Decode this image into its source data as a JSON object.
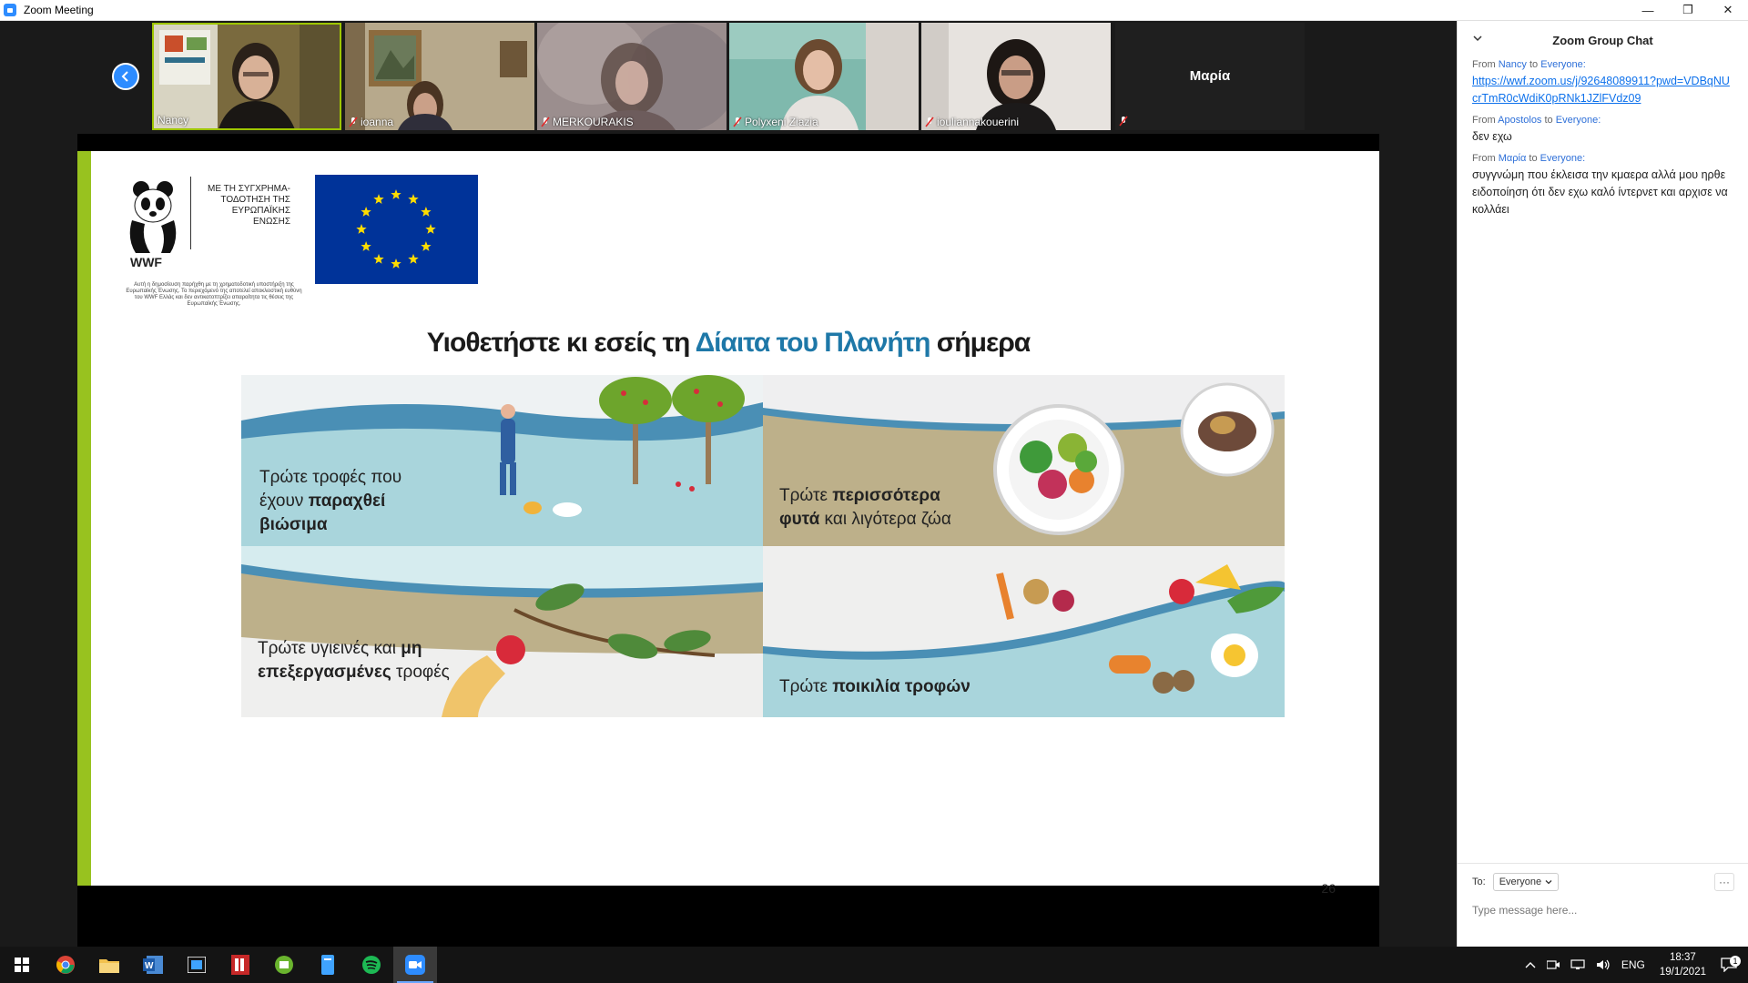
{
  "window": {
    "title": "Zoom Meeting",
    "controls": {
      "minimize": "—",
      "restore": "❐",
      "close": "✕"
    }
  },
  "participants": [
    {
      "name": "Nancy",
      "muted": false,
      "speaking": true
    },
    {
      "name": "ioanna",
      "muted": true
    },
    {
      "name": "MERKOURAKIS",
      "muted": true
    },
    {
      "name": "Polyxeni Ziazia",
      "muted": true
    },
    {
      "name": "iouliannakouerini",
      "muted": true
    },
    {
      "name": "Μαρία",
      "muted": true,
      "video_off": true
    }
  ],
  "slide": {
    "logo_text": "WWF",
    "cofund_text": "ΜΕ ΤΗ ΣΥΓΧΡΗΜΑ-ΤΟΔΟΤΗΣΗ ΤΗΣ ΕΥΡΩΠΑΪΚΗΣ ΕΝΩΣΗΣ",
    "disclaimer": "Αυτή η δημοσίευση παρήχθη με τη χρηματοδοτική υποστήριξη της Ευρωπαϊκής Ένωσης. Το περιεχόμενό της αποτελεί αποκλειστική ευθύνη του WWF Ελλάς και δεν αντικατοπτρίζει απαραίτητα τις θέσεις της Ευρωπαϊκής Ένωσης.",
    "title_start": "Υιοθετήστε κι εσείς τη ",
    "title_accent": "Δίαιτα του Πλανήτη",
    "title_end": " σήμερα",
    "panels": [
      {
        "text_a": "Τρώτε τροφές που έχουν ",
        "text_b": "παραχθεί βιώσιμα"
      },
      {
        "text_a": "Τρώτε ",
        "text_b": "περισσότερα φυτά",
        "text_c": " και λιγότερα ζώα"
      },
      {
        "text_a": "Τρώτε υγιεινές και ",
        "text_b": "μη επεξεργασμένες",
        "text_c": " τροφές"
      },
      {
        "text_a": "Τρώτε ",
        "text_b": "ποικιλία τροφών"
      }
    ],
    "page_number": "26"
  },
  "chat": {
    "title": "Zoom Group Chat",
    "messages": [
      {
        "from": "Nancy",
        "to": "Everyone:",
        "body": "https://wwf.zoom.us/j/92648089911?pwd=VDBqNUcrTmR0cWdiK0pRNk1JZlFVdz09",
        "is_link": true
      },
      {
        "from": "Apostolos",
        "to": "Everyone:",
        "body": "δεν εχω",
        "is_link": false
      },
      {
        "from": "Μαρία",
        "to": "Everyone:",
        "body": "συγγνώμη που έκλεισα την κμαερα αλλά μου ηρθε ειδοποίηση ότι δεν εχω καλό ίντερνετ και αρχισε να κολλάει",
        "is_link": false
      }
    ],
    "from_label": "From",
    "to_label": "to",
    "recipient_label": "To:",
    "recipient_value": "Everyone",
    "more_label": "···",
    "input_placeholder": "Type message here..."
  },
  "taskbar": {
    "language": "ENG",
    "time": "18:37",
    "date": "19/1/2021",
    "notification_count": "1"
  },
  "colors": {
    "zoom_blue": "#2d8cff",
    "slide_accent": "#1e78a8",
    "slide_green": "#98c21f",
    "eu_blue": "#003399",
    "eu_star": "#ffdd00"
  }
}
